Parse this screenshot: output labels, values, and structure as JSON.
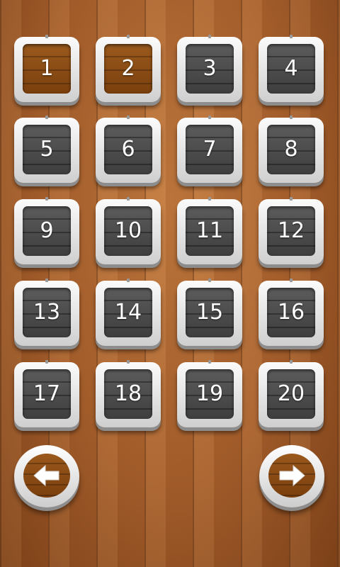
{
  "levels": [
    {
      "label": "1",
      "state": "unlocked"
    },
    {
      "label": "2",
      "state": "unlocked"
    },
    {
      "label": "3",
      "state": "locked"
    },
    {
      "label": "4",
      "state": "locked"
    },
    {
      "label": "5",
      "state": "locked"
    },
    {
      "label": "6",
      "state": "locked"
    },
    {
      "label": "7",
      "state": "locked"
    },
    {
      "label": "8",
      "state": "locked"
    },
    {
      "label": "9",
      "state": "locked"
    },
    {
      "label": "10",
      "state": "locked"
    },
    {
      "label": "11",
      "state": "locked"
    },
    {
      "label": "12",
      "state": "locked"
    },
    {
      "label": "13",
      "state": "locked"
    },
    {
      "label": "14",
      "state": "locked"
    },
    {
      "label": "15",
      "state": "locked"
    },
    {
      "label": "16",
      "state": "locked"
    },
    {
      "label": "17",
      "state": "locked"
    },
    {
      "label": "18",
      "state": "locked"
    },
    {
      "label": "19",
      "state": "locked"
    },
    {
      "label": "20",
      "state": "locked"
    }
  ],
  "navigation": {
    "prev_icon": "arrow-left-icon",
    "next_icon": "arrow-right-icon"
  },
  "colors": {
    "unlocked_tile": "#8a4a14",
    "locked_tile": "#4a4a4a",
    "frame": "#e8e8e8",
    "background_wood": "#a65f2c"
  }
}
